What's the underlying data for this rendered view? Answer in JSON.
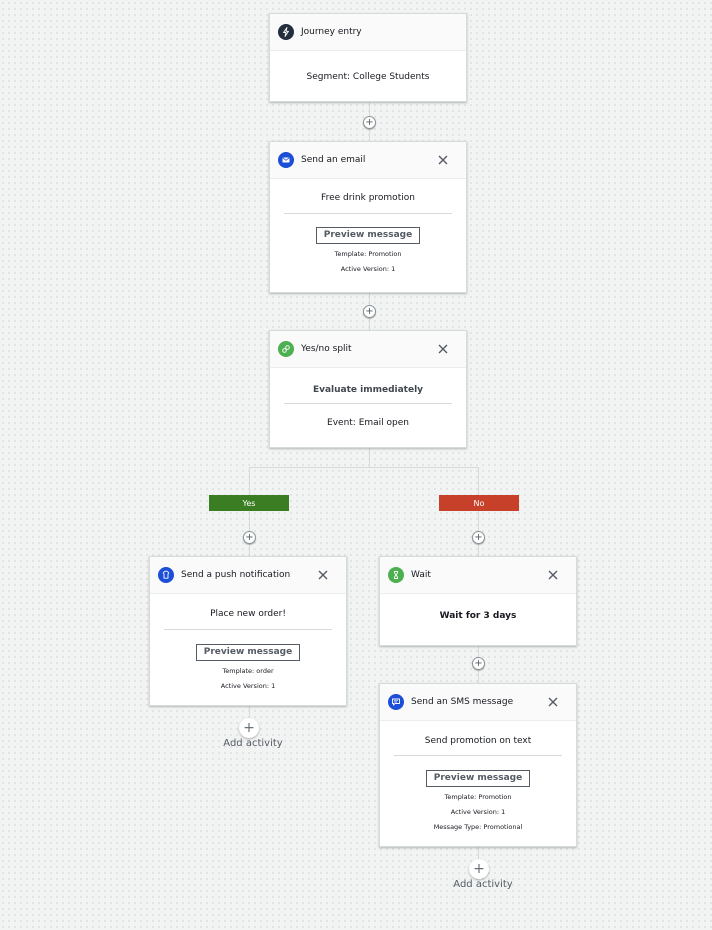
{
  "colors": {
    "entry_icon": "#232f3e",
    "email_icon": "#1d4ed8",
    "split_icon": "#4caf50",
    "push_icon": "#1d4ed8",
    "wait_icon": "#4caf50",
    "sms_icon": "#1d4ed8",
    "yes_branch": "#3b7d23",
    "no_branch": "#c7402a"
  },
  "journey_entry": {
    "title": "Journey entry",
    "icon": "lightning-icon",
    "segment": "Segment: College Students"
  },
  "email": {
    "title": "Send an email",
    "icon": "envelope-icon",
    "description": "Free drink promotion",
    "preview_label": "Preview message",
    "template": "Template: Promotion",
    "active_version": "Active Version: 1"
  },
  "split": {
    "title": "Yes/no split",
    "icon": "split-icon",
    "evaluation": "Evaluate immediately",
    "event": "Event:  Email open"
  },
  "branches": {
    "yes_label": "Yes",
    "no_label": "No"
  },
  "push": {
    "title": "Send a push notification",
    "icon": "bell-icon",
    "description": "Place new order!",
    "preview_label": "Preview message",
    "template": "Template: order",
    "active_version": "Active Version: 1"
  },
  "wait": {
    "title": "Wait",
    "icon": "hourglass-icon",
    "description": "Wait for 3 days"
  },
  "sms": {
    "title": "Send an SMS message",
    "icon": "chat-icon",
    "description": "Send promotion on text",
    "preview_label": "Preview message",
    "template": "Template: Promotion",
    "active_version": "Active Version: 1",
    "message_type": "Message Type: Promotional"
  },
  "add_activity": {
    "plus_glyph": "+",
    "label": "Add activity"
  },
  "insert_glyph": "+"
}
